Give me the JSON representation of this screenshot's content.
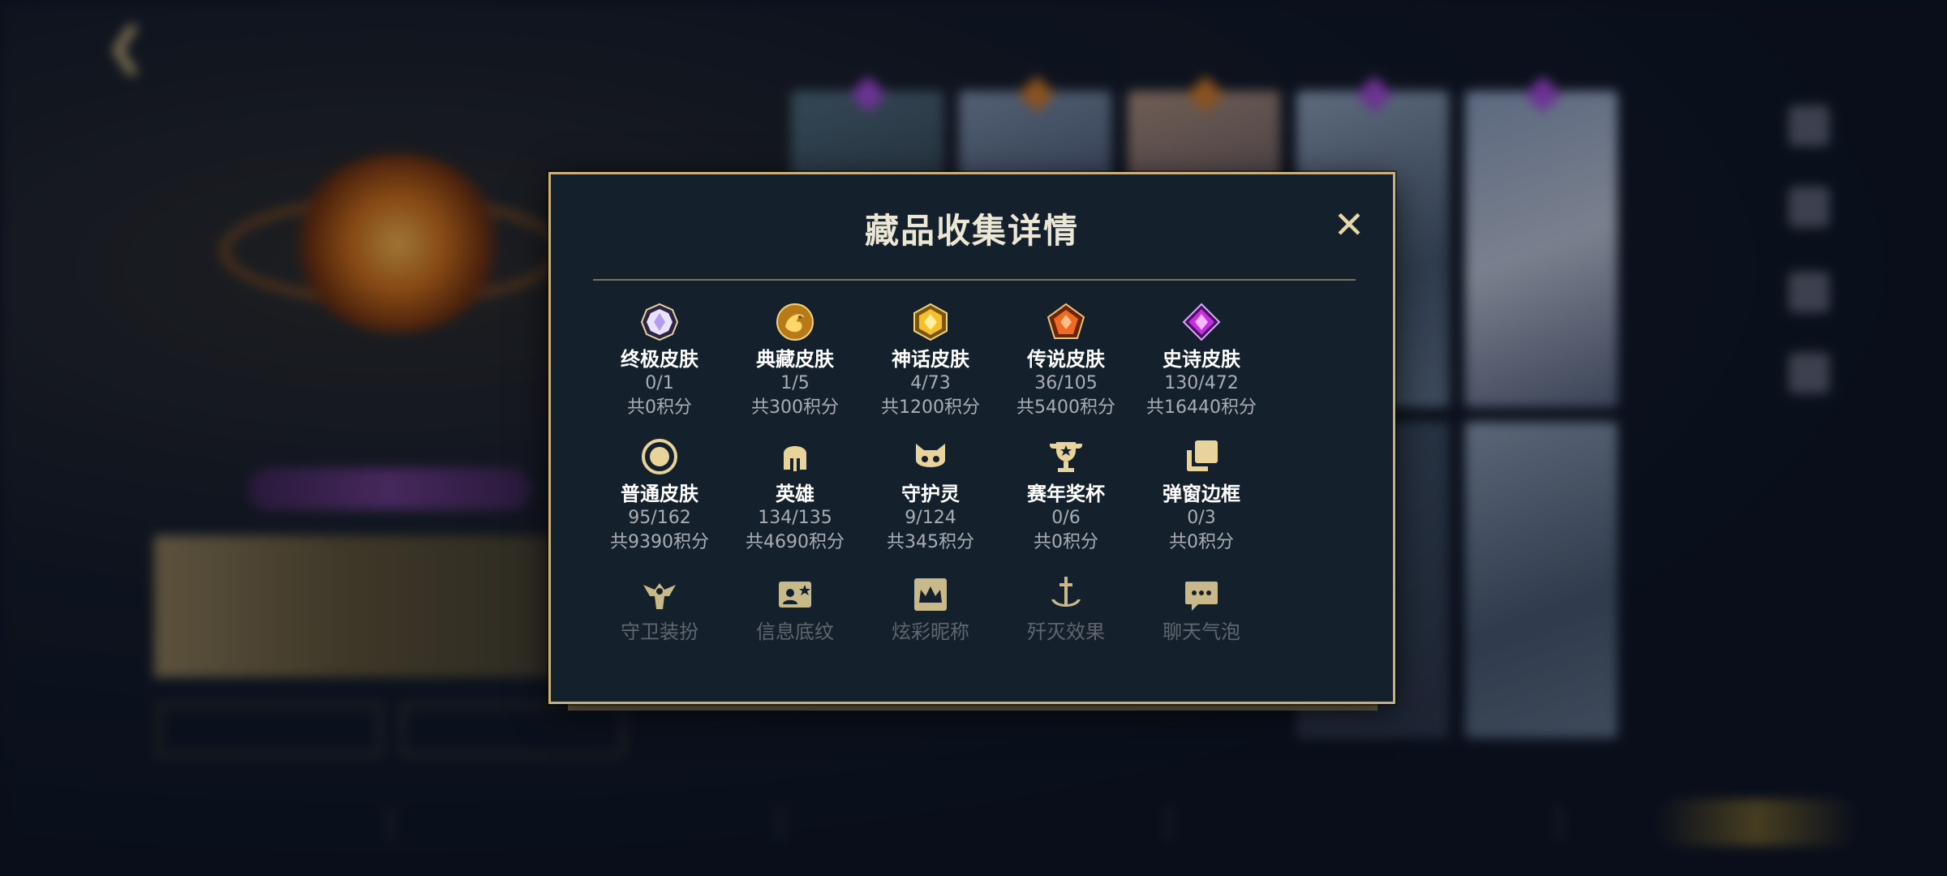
{
  "colors": {
    "modal_bg": "#14202b",
    "modal_border": "#c9b078",
    "title_text": "#ece6d4",
    "label_text": "#ffffff",
    "meta_text": "#a9adb4",
    "dim_text": "#5f6670",
    "icon_gold": "#e8d49b"
  },
  "modal": {
    "title": "藏品收集详情",
    "close_icon": "close-icon",
    "rows": [
      [
        {
          "label": "终极皮肤",
          "count": "0/1",
          "points": "共0积分",
          "icon": "ultimate-skin-gem-icon"
        },
        {
          "label": "典藏皮肤",
          "count": "1/5",
          "points": "共300积分",
          "icon": "collection-skin-dragon-icon"
        },
        {
          "label": "神话皮肤",
          "count": "4/73",
          "points": "共1200积分",
          "icon": "mythic-skin-gem-icon"
        },
        {
          "label": "传说皮肤",
          "count": "36/105",
          "points": "共5400积分",
          "icon": "legend-skin-gem-icon"
        },
        {
          "label": "史诗皮肤",
          "count": "130/472",
          "points": "共16440积分",
          "icon": "epic-skin-gem-icon"
        }
      ],
      [
        {
          "label": "普通皮肤",
          "count": "95/162",
          "points": "共9390积分",
          "icon": "normal-skin-ring-icon"
        },
        {
          "label": "英雄",
          "count": "134/135",
          "points": "共4690积分",
          "icon": "hero-helmet-icon"
        },
        {
          "label": "守护灵",
          "count": "9/124",
          "points": "共345积分",
          "icon": "guardian-spirit-icon"
        },
        {
          "label": "赛年奖杯",
          "count": "0/6",
          "points": "共0积分",
          "icon": "season-trophy-icon"
        },
        {
          "label": "弹窗边框",
          "count": "0/3",
          "points": "共0积分",
          "icon": "popup-frame-icon"
        }
      ],
      [
        {
          "label": "守卫装扮",
          "icon": "guard-outfit-icon"
        },
        {
          "label": "信息底纹",
          "icon": "info-card-icon"
        },
        {
          "label": "炫彩昵称",
          "icon": "crown-nickname-icon"
        },
        {
          "label": "歼灭效果",
          "icon": "sword-effect-icon"
        },
        {
          "label": "聊天气泡",
          "icon": "chat-bubble-icon"
        }
      ]
    ]
  }
}
